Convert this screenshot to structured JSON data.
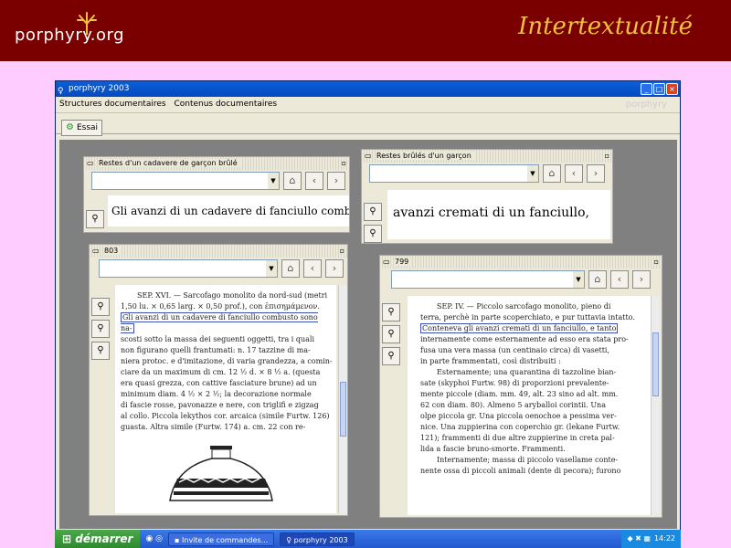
{
  "banner": {
    "logo_text": "porphyry.org",
    "title": "Intertextualité"
  },
  "app": {
    "window_title": "porphyry 2003",
    "menu": [
      "Structures documentaires",
      "Contenus documentaires"
    ],
    "menu_brand": "porphyry",
    "toolbar_button": "Essai"
  },
  "frames": {
    "f1": {
      "title": "Restes d'un cadavere de garçon brûlé",
      "text": "Gli avanzi di un cadavere di fanciullo combusto s"
    },
    "f2": {
      "title": "Restes brûlés d'un garçon",
      "text": "avanzi cremati di un fanciullo,"
    },
    "f3": {
      "title": "803",
      "lines": [
        "SEP. XVI. — Sarcofago monolito da nord-sud (metri",
        "1,50 lu. × 0,65 larg. × 0,50 prof.), con ἐπισημάμενον.",
        "Gli avanzi di un cadavere di fanciullo combusto sono na-",
        "scosti sotto la massa dei seguenti oggetti, tra i quali",
        "non figurano quelli frantumati: n. 17 tazzine di ma-",
        "niera protoc. e d'imitazione, di varia grandezza, a comin-",
        "ciare da un maximum di cm. 12 ½ d. × 8 ½ a. (questa",
        "era quasi grezza, con cattive fasciature brune) ad un",
        "minimum diam. 4 ½ × 2 ½; la decorazione normale",
        "di fascie rosse, pavonazze e nere, con triglifi e zigzag",
        "al collo. Piccola lekythos cor. arcaica (simile Furtw. 126)",
        "guasta. Altra simile (Furtw. 174) a. cm. 22 con re-"
      ]
    },
    "f4": {
      "title": "799",
      "lines": [
        "SEP. IV. — Piccolo sarcofago monolito, pieno di",
        "terra, perchè in parte scoperchiato, e pur tuttavia intatto.",
        "Conteneva gli avanzi cremati di un fanciullo, e tanto",
        "internamente come esternamente ad esso era stata pro-",
        "fusa una vera massa (un centinaio circa) di vasetti,",
        "in parte frammentati, così distribuiti :",
        "Esternamente; una quarantina di tazzoline bian-",
        "sate (skyphoi Furtw. 98) di proporzioni prevalente-",
        "mente piccole (diam. mm. 49, alt. 23 sino ad alt. mm.",
        "62 con diam. 80). Almeno 5 aryballoi corintii. Una",
        "olpe piccola gr. Una piccola oenochoe a pessima ver-",
        "nice. Una zuppierina con coperchio gr. (lekane Furtw.",
        "121); frammenti di due altre zuppierine in creta pal-",
        "lida a fascie bruno-smorte. Frammenti.",
        "Internamente; massa di piccolo vasellame conte-",
        "nente ossa di piccoli animali (dente di pecora); furono"
      ]
    }
  },
  "taskbar": {
    "start": "démarrer",
    "tasks": [
      "Invite de commandes...",
      "porphyry 2003"
    ],
    "clock": "14:22"
  },
  "colors": {
    "banner": "#7a0000",
    "title": "#f0c040",
    "background": "#ffccff"
  }
}
